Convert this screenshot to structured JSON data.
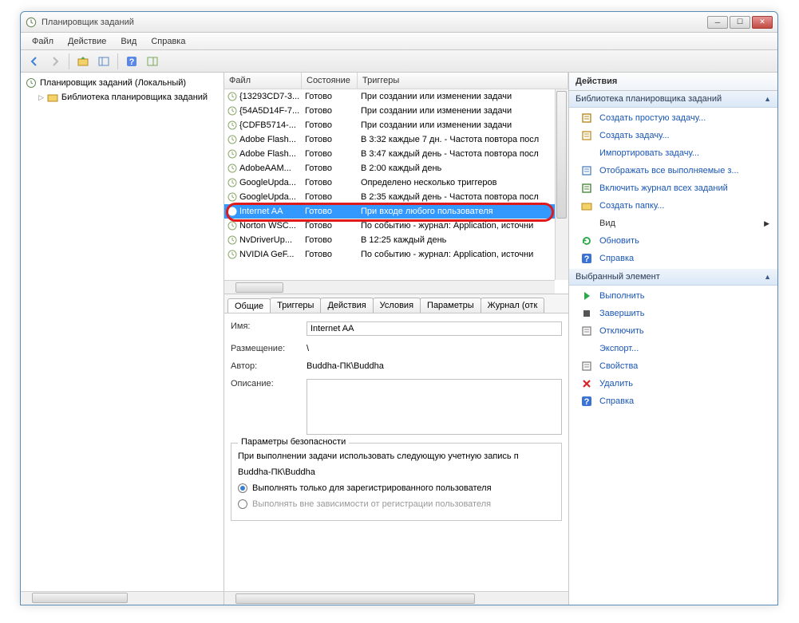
{
  "window": {
    "title": "Планировщик заданий"
  },
  "menu": {
    "file": "Файл",
    "action": "Действие",
    "view": "Вид",
    "help": "Справка"
  },
  "tree": {
    "root": "Планировщик заданий (Локальный)",
    "lib": "Библиотека планировщика заданий"
  },
  "cols": {
    "file": "Файл",
    "state": "Состояние",
    "triggers": "Триггеры"
  },
  "tasks": [
    {
      "name": "{13293CD7-3...",
      "state": "Готово",
      "trig": "При создании или изменении задачи"
    },
    {
      "name": "{54A5D14F-7...",
      "state": "Готово",
      "trig": "При создании или изменении задачи"
    },
    {
      "name": "{CDFB5714-...",
      "state": "Готово",
      "trig": "При создании или изменении задачи"
    },
    {
      "name": "Adobe Flash...",
      "state": "Готово",
      "trig": "В 3:32 каждые 7 дн. - Частота повтора посл"
    },
    {
      "name": "Adobe Flash...",
      "state": "Готово",
      "trig": "В 3:47 каждый день - Частота повтора посл"
    },
    {
      "name": "AdobeAAM...",
      "state": "Готово",
      "trig": "В 2:00 каждый день"
    },
    {
      "name": "GoogleUpda...",
      "state": "Готово",
      "trig": "Определено несколько триггеров"
    },
    {
      "name": "GoogleUpda...",
      "state": "Готово",
      "trig": "В 2:35 каждый день - Частота повтора посл"
    },
    {
      "name": "Internet AA",
      "state": "Готово",
      "trig": "При входе любого пользователя",
      "sel": true
    },
    {
      "name": "Norton WSC...",
      "state": "Готово",
      "trig": "По событию - журнал: Application, источни"
    },
    {
      "name": "NvDriverUp...",
      "state": "Готово",
      "trig": "В 12:25 каждый день"
    },
    {
      "name": "NVIDIA GeF...",
      "state": "Готово",
      "trig": "По событию - журнал: Application, источни"
    }
  ],
  "tabs": {
    "general": "Общие",
    "triggers": "Триггеры",
    "actions": "Действия",
    "conditions": "Условия",
    "settings": "Параметры",
    "history": "Журнал (отк"
  },
  "form": {
    "name_lbl": "Имя:",
    "name_val": "Internet AA",
    "location_lbl": "Размещение:",
    "location_val": "\\",
    "author_lbl": "Автор:",
    "author_val": "Buddha-ПК\\Buddha",
    "desc_lbl": "Описание:"
  },
  "sec": {
    "title": "Параметры безопасности",
    "line1": "При выполнении задачи использовать следующую учетную запись п",
    "account": "Buddha-ПК\\Buddha",
    "opt1": "Выполнять только для зарегистрированного пользователя",
    "opt2": "Выполнять вне зависимости от регистрации пользователя"
  },
  "actions": {
    "hdr": "Действия",
    "lib_sub": "Библиотека планировщика заданий",
    "items1": [
      {
        "k": "create_basic",
        "t": "Создать простую задачу...",
        "c": "#b88a1f"
      },
      {
        "k": "create",
        "t": "Создать задачу...",
        "c": "#c7962e"
      },
      {
        "k": "import",
        "t": "Импортировать задачу..."
      },
      {
        "k": "show_all",
        "t": "Отображать все выполняемые з...",
        "c": "#5a88c7"
      },
      {
        "k": "enable_hist",
        "t": "Включить журнал всех заданий",
        "c": "#4a8a3a"
      },
      {
        "k": "new_folder",
        "t": "Создать папку...",
        "c": "#d8b24a"
      },
      {
        "k": "view",
        "t": "Вид",
        "plain": true,
        "sub": true
      },
      {
        "k": "refresh",
        "t": "Обновить",
        "c": "#2aa84a"
      },
      {
        "k": "help",
        "t": "Справка",
        "c": "#2b63c4"
      }
    ],
    "sel_sub": "Выбранный элемент",
    "items2": [
      {
        "k": "run",
        "t": "Выполнить",
        "c": "#2aa84a"
      },
      {
        "k": "end",
        "t": "Завершить",
        "c": "#555"
      },
      {
        "k": "disable",
        "t": "Отключить",
        "c": "#888"
      },
      {
        "k": "export",
        "t": "Экспорт..."
      },
      {
        "k": "props",
        "t": "Свойства",
        "c": "#888"
      },
      {
        "k": "delete",
        "t": "Удалить",
        "c": "#d22"
      },
      {
        "k": "help2",
        "t": "Справка",
        "c": "#2b63c4"
      }
    ]
  }
}
